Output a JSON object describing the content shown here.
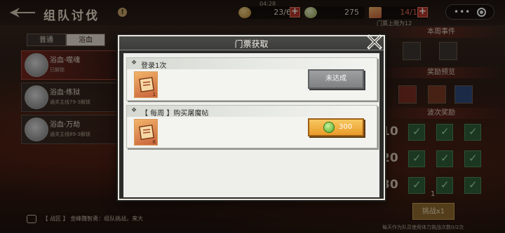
{
  "header": {
    "title": "组队讨伐",
    "time": "04:28",
    "stamina": "23/60",
    "currency": "275",
    "tickets": "14/12",
    "ticket_hint": "门票上限为12"
  },
  "tabs": [
    "普通",
    "浴血"
  ],
  "bosses": [
    {
      "name": "浴血·噬魂",
      "sub": "已解锁"
    },
    {
      "name": "浴血·练狱",
      "sub": "通关主线79-3解锁"
    },
    {
      "name": "浴血·万劫",
      "sub": "通关主线89-3解锁"
    }
  ],
  "right_panel": {
    "events_title": "本周事件",
    "rewards_title": "奖励预览",
    "stage_rewards_title": "波次奖励",
    "rows": [
      "10",
      "20",
      "30"
    ],
    "ticket_cost": "1",
    "fight_label": "挑战x1",
    "note": "每天作为队员使用体力挑战次数0/2次"
  },
  "chat": {
    "prefix": "【 战区 】",
    "text": "金峰魏智勇：组队挑战，来大"
  },
  "modal": {
    "title": "门票获取",
    "tasks": [
      {
        "label": "登录1次",
        "item_count": "1",
        "button_label": "未达成",
        "button_type": "disabled"
      },
      {
        "label": "【 每周 】购买屠魔帖",
        "item_count": "8",
        "button_label": "300",
        "button_type": "buy"
      }
    ]
  },
  "colors": {
    "modal_border": "#e9e6de",
    "gold_button": "#f0b03f",
    "gray_button": "#8e9092",
    "jade": "#4da52a"
  },
  "icons": [
    "back-icon",
    "info-icon",
    "coin-icon",
    "plus-icon",
    "more-icon",
    "close-icon",
    "ticket-icon",
    "jade-icon"
  ]
}
